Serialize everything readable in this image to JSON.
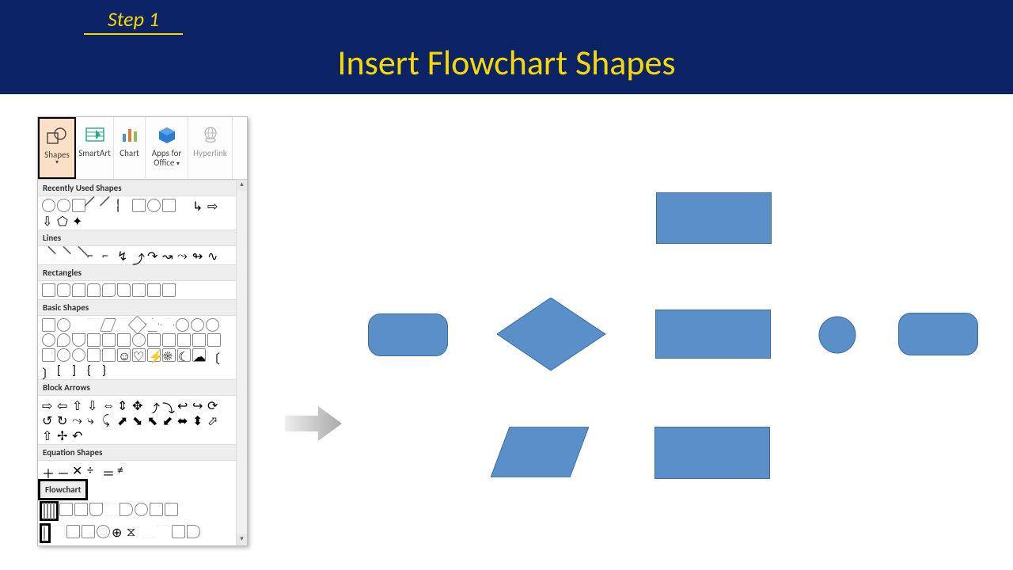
{
  "header": {
    "step": "Step 1",
    "title": "Insert Flowchart Shapes"
  },
  "ribbon": {
    "shapes": "Shapes",
    "smartart": "SmartArt",
    "chart": "Chart",
    "apps_line1": "Apps for",
    "apps_line2": "Office",
    "hyperlink": "Hyperlink"
  },
  "categories": {
    "recent": "Recently Used Shapes",
    "lines": "Lines",
    "rects": "Rectangles",
    "basic": "Basic Shapes",
    "block": "Block Arrows",
    "eq": "Equation Shapes",
    "flow": "Flowchart"
  },
  "colors": {
    "shape_fill": "#5b8fc7",
    "shape_border": "#3d6aa0",
    "header_bg": "#0b2265",
    "accent": "#f7d900"
  },
  "canvas_shapes": [
    {
      "name": "process-rect-top",
      "type": "rect"
    },
    {
      "name": "terminator-roundrect",
      "type": "roundrect"
    },
    {
      "name": "decision-diamond",
      "type": "diamond"
    },
    {
      "name": "process-rect-mid",
      "type": "rect"
    },
    {
      "name": "connector-circle",
      "type": "circle"
    },
    {
      "name": "roundrect-right",
      "type": "roundrect"
    },
    {
      "name": "data-parallelogram",
      "type": "parallelogram"
    },
    {
      "name": "process-rect-bottom",
      "type": "rect"
    }
  ]
}
